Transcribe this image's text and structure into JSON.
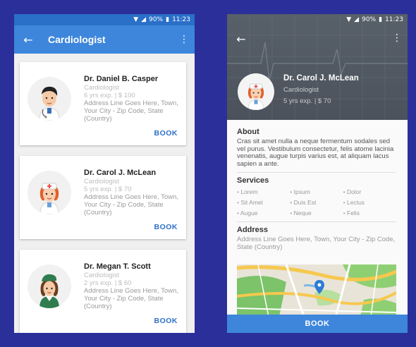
{
  "status": {
    "battery": "90%",
    "time": "11:23"
  },
  "list_screen": {
    "title": "Cardiologist",
    "doctors": [
      {
        "name": "Dr. Daniel B. Casper",
        "specialty": "Cardiologist",
        "exp": "6 yrs exp. | $ 100",
        "address": "Address Line Goes Here, Town, Your City - Zip Code, State (Country)",
        "book": "BOOK"
      },
      {
        "name": "Dr. Carol J. McLean",
        "specialty": "Cardiologist",
        "exp": "5 yrs exp. | $ 70",
        "address": "Address Line Goes Here, Town, Your City - Zip Code, State (Country)",
        "book": "BOOK"
      },
      {
        "name": "Dr. Megan T. Scott",
        "specialty": "Cardiologist",
        "exp": "2 yrs exp. | $ 60",
        "address": "Address Line Goes Here, Town, Your City - Zip Code, State (Country)",
        "book": "BOOK"
      }
    ]
  },
  "detail_screen": {
    "name": "Dr. Carol J. McLean",
    "specialty": "Cardiologist",
    "exp": "5 yrs exp. | $ 70",
    "about_title": "About",
    "about_text": "Cras sit amet nulla a neque fermentum sodales sed vel purus. Vestibulum consectetur, felis atome lacinia venenatis, augue turpis varius est, at aliquam lacus sapien a ante.",
    "services_title": "Services",
    "services": [
      "Lorem",
      "Ipsum",
      "Dolor",
      "Sit Amet",
      "Duis Est",
      "Lectus",
      "Augue",
      "Neque",
      "Felis"
    ],
    "address_title": "Address",
    "address": "Address Line Goes Here, Town, Your City - Zip Code, State (Country)",
    "book": "BOOK"
  },
  "icons": {
    "back": "arrow-back-icon",
    "more": "more-vert-icon",
    "wifi": "wifi-icon",
    "signal": "signal-icon",
    "battery": "battery-icon",
    "map_pin": "map-pin-icon"
  },
  "colors": {
    "primary": "#3d86dc",
    "statusbar": "#2a6fc8",
    "accent_link": "#2d6fc7",
    "background": "#2b2f9a",
    "hero": "#535a63"
  }
}
